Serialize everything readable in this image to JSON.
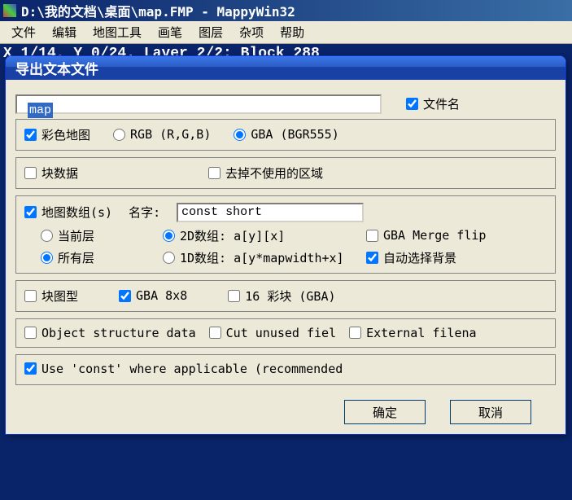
{
  "main": {
    "title": "D:\\我的文档\\桌面\\map.FMP - MappyWin32"
  },
  "menu": {
    "items": [
      "文件",
      "编辑",
      "地图工具",
      "画笔",
      "图层",
      "杂项",
      "帮助"
    ]
  },
  "status": "X 1/14, Y 0/24. Layer 2/2: Block 288",
  "dialog": {
    "title": "导出文本文件",
    "filename_value": "map",
    "filename_label": "文件名",
    "color_map": "彩色地图",
    "rgb": "RGB (R,G,B)",
    "gba": "GBA (BGR555)",
    "block_data": "块数据",
    "remove_unused": "去掉不使用的区域",
    "map_arrays": "地图数组(s)",
    "name_label": "名字:",
    "name_value": "const short",
    "current_layer": "当前层",
    "all_layers": "所有层",
    "arr_2d": "2D数组: a[y][x]",
    "arr_1d": "1D数组: a[y*mapwidth+x]",
    "gba_merge": "GBA Merge flip",
    "auto_bg": "自动选择背景",
    "block_gfx": "块图型",
    "gba_8x8": "GBA 8x8",
    "colors_16": "16 彩块 (GBA)",
    "obj_struct": "Object structure data",
    "cut_unused": "Cut unused fiel",
    "external_file": "External filena",
    "use_const": "Use 'const' where applicable (recommended",
    "ok": "确定",
    "cancel": "取消"
  }
}
